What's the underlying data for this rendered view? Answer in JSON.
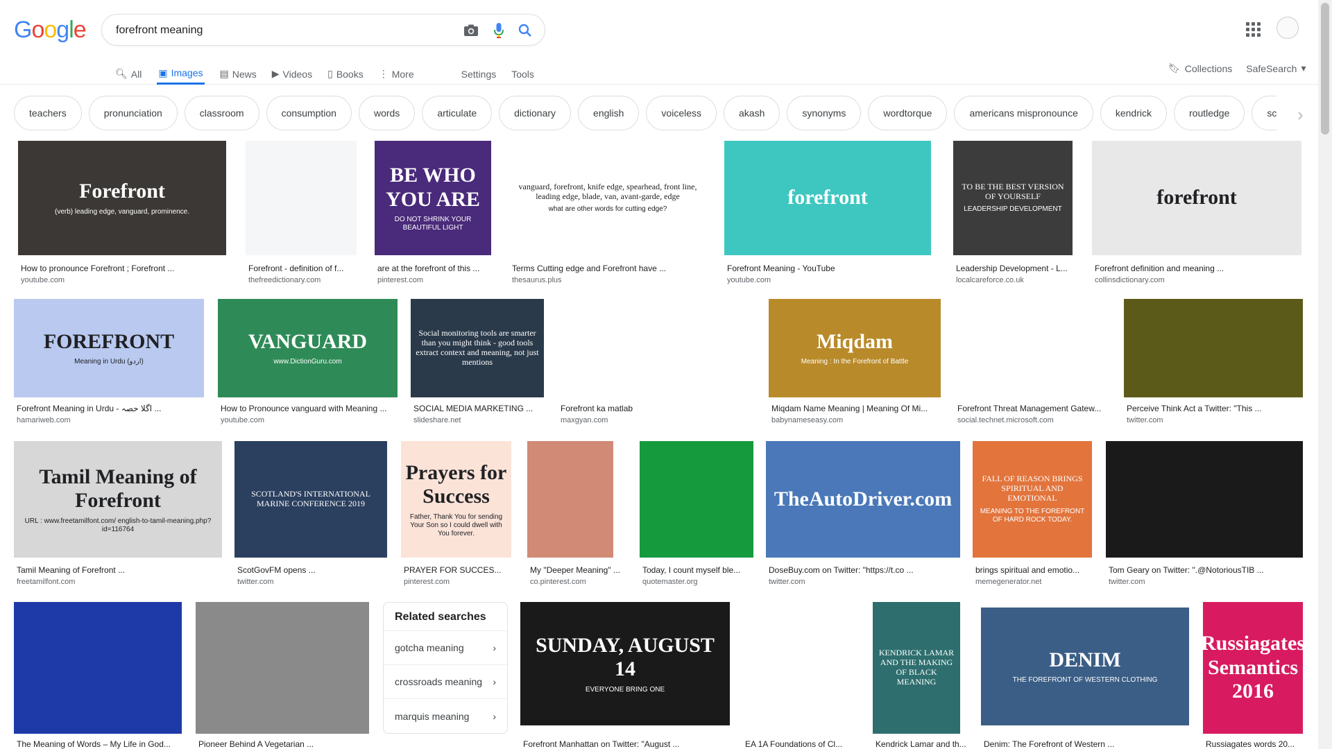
{
  "logo": {
    "letters": [
      "G",
      "o",
      "o",
      "g",
      "l",
      "e"
    ],
    "colors": [
      "#4285f4",
      "#ea4335",
      "#fbbc05",
      "#4285f4",
      "#34a853",
      "#ea4335"
    ]
  },
  "search": {
    "query": "forefront meaning",
    "icons": [
      "camera-icon",
      "mic-icon",
      "search-icon"
    ]
  },
  "tabs": [
    {
      "label": "All",
      "icon": "search-icon"
    },
    {
      "label": "Images",
      "icon": "image-icon",
      "active": true
    },
    {
      "label": "News",
      "icon": "news-icon"
    },
    {
      "label": "Videos",
      "icon": "video-icon"
    },
    {
      "label": "Books",
      "icon": "book-icon"
    },
    {
      "label": "More",
      "icon": "dots-icon"
    }
  ],
  "tools": {
    "settings": "Settings",
    "tools": "Tools"
  },
  "right_tools": {
    "collections": "Collections",
    "safesearch": "SafeSearch"
  },
  "chips": [
    "teachers",
    "pronunciation",
    "classroom",
    "consumption",
    "words",
    "articulate",
    "dictionary",
    "english",
    "voiceless",
    "akash",
    "synonyms",
    "wordtorque",
    "americans mispronounce",
    "kendrick",
    "routledge",
    "scotland"
  ],
  "results": [
    {
      "caption": "How to pronounce Forefront ; Forefront ...",
      "domain": "youtube.com",
      "thumb_text": "Forefront",
      "thumb_sub": "(verb) leading edge, vanguard, prominence.",
      "color": "#3b3835"
    },
    {
      "caption": "Forefront - definition of f...",
      "domain": "thefreedictionary.com",
      "thumb_text": "",
      "thumb_sub": "",
      "color": "#f4f6f8"
    },
    {
      "caption": "are at the forefront of this ...",
      "domain": "pinterest.com",
      "thumb_text": "BE WHO YOU ARE",
      "thumb_sub": "DO NOT SHRINK YOUR BEAUTIFUL LIGHT",
      "color": "#4a2a7a"
    },
    {
      "caption": "Terms Cutting edge and Forefront have ...",
      "domain": "thesaurus.plus",
      "thumb_text": "vanguard, forefront, knife edge, spearhead, front line, leading edge, blade, van, avant-garde, edge",
      "thumb_sub": "what are other words for cutting edge?",
      "color": "#ffffff"
    },
    {
      "caption": "Forefront Meaning - YouTube",
      "domain": "youtube.com",
      "thumb_text": "forefront",
      "thumb_sub": "",
      "color": "#3ec7c0"
    },
    {
      "caption": "Leadership Development - L...",
      "domain": "localcareforce.co.uk",
      "thumb_text": "TO BE THE BEST VERSION OF YOURSELF",
      "thumb_sub": "LEADERSHIP DEVELOPMENT",
      "color": "#3c3c3c"
    },
    {
      "caption": "Forefront definition and meaning ...",
      "domain": "collinsdictionary.com",
      "thumb_text": "forefront",
      "thumb_sub": "",
      "color": "#e8e8e8"
    },
    {
      "caption": "Forefront Meaning in Urdu - اگلا حصہ ...",
      "domain": "hamariweb.com",
      "thumb_text": "FOREFRONT",
      "thumb_sub": "Meaning in Urdu (اردو)",
      "color": "#b9c9f0"
    },
    {
      "caption": "How to Pronounce vanguard with Meaning ...",
      "domain": "youtube.com",
      "thumb_text": "VANGUARD",
      "thumb_sub": "www.DictionGuru.com",
      "color": "#2e8b57"
    },
    {
      "caption": "SOCIAL MEDIA MARKETING ...",
      "domain": "slideshare.net",
      "thumb_text": "Social monitoring tools are smarter than you might think - good tools extract context and meaning, not just mentions",
      "thumb_sub": "",
      "color": "#2a3a4a"
    },
    {
      "caption": "Forefront ka matlab",
      "domain": "maxgyan.com",
      "thumb_text": "",
      "thumb_sub": "",
      "color": "#ffffff"
    },
    {
      "caption": "Miqdam Name Meaning | Meaning Of Mi...",
      "domain": "babynameseasy.com",
      "thumb_text": "Miqdam",
      "thumb_sub": "Meaning : In the Forefront of Battle",
      "color": "#b88a2a"
    },
    {
      "caption": "Forefront Threat Management Gatew...",
      "domain": "social.technet.microsoft.com",
      "thumb_text": "",
      "thumb_sub": "",
      "color": "#ffffff"
    },
    {
      "caption": "Perceive Think Act a Twitter: \"This ...",
      "domain": "twitter.com",
      "thumb_text": "",
      "thumb_sub": "",
      "color": "#5c5a18"
    },
    {
      "caption": "Tamil Meaning of Forefront ...",
      "domain": "freetamilfont.com",
      "thumb_text": "Tamil Meaning of Forefront",
      "thumb_sub": "URL : www.freetamilfont.com/ english-to-tamil-meaning.php?id=116764",
      "color": "#d7d7d7"
    },
    {
      "caption": "ScotGovFM opens ...",
      "domain": "twitter.com",
      "thumb_text": "SCOTLAND'S INTERNATIONAL MARINE CONFERENCE 2019",
      "thumb_sub": "",
      "color": "#2b3f5f"
    },
    {
      "caption": "PRAYER FOR SUCCES...",
      "domain": "pinterest.com",
      "thumb_text": "Prayers for Success",
      "thumb_sub": "Father, Thank You for sending Your Son so I could dwell with You forever.",
      "color": "#fbe3d8"
    },
    {
      "caption": "My \"Deeper Meaning\" ...",
      "domain": "co.pinterest.com",
      "thumb_text": "",
      "thumb_sub": "",
      "color": "#d08a76"
    },
    {
      "caption": "Today, I count myself ble...",
      "domain": "quotemaster.org",
      "thumb_text": "",
      "thumb_sub": "",
      "color": "#169a3e"
    },
    {
      "caption": "DoseBuy.com on Twitter: \"https://t.co ...",
      "domain": "twitter.com",
      "thumb_text": "TheAutoDriver.com",
      "thumb_sub": "",
      "color": "#4a78b8"
    },
    {
      "caption": "brings spiritual and emotio...",
      "domain": "memegenerator.net",
      "thumb_text": "FALL OF REASON BRINGS SPIRITUAL AND EMOTIONAL",
      "thumb_sub": "MEANING TO THE FOREFRONT OF HARD ROCK TODAY.",
      "color": "#e2743c"
    },
    {
      "caption": "Tom Geary on Twitter: \".@NotoriousTIB ...",
      "domain": "twitter.com",
      "thumb_text": "",
      "thumb_sub": "",
      "color": "#1a1a1a"
    },
    {
      "caption": "The Meaning of Words – My Life in God...",
      "domain": "",
      "thumb_text": "",
      "thumb_sub": "",
      "color": "#1e3aa8"
    },
    {
      "caption": "Pioneer Behind A Vegetarian ...",
      "domain": "",
      "thumb_text": "",
      "thumb_sub": "",
      "color": "#8a8a8a"
    },
    {
      "caption": "Forefront Manhattan on Twitter: \"August ...",
      "domain": "",
      "thumb_text": "SUNDAY, AUGUST 14",
      "thumb_sub": "EVERYONE BRING ONE",
      "color": "#1a1a1a"
    },
    {
      "caption": "EA 1A Foundations of Cl...",
      "domain": "",
      "thumb_text": "",
      "thumb_sub": "",
      "color": "#ffffff"
    },
    {
      "caption": "Kendrick Lamar and th...",
      "domain": "",
      "thumb_text": "KENDRICK LAMAR AND THE MAKING OF BLACK MEANING",
      "thumb_sub": "",
      "color": "#2e6e6e"
    },
    {
      "caption": "Denim: The Forefront of Western ...",
      "domain": "",
      "thumb_text": "DENIM",
      "thumb_sub": "THE FOREFRONT OF WESTERN CLOTHING",
      "color": "#3b5e86"
    },
    {
      "caption": "Russiagates words 20...",
      "domain": "",
      "thumb_text": "Russiagates Semantics 2016",
      "thumb_sub": "",
      "color": "#d81b60"
    }
  ],
  "related": {
    "title": "Related searches",
    "items": [
      "gotcha meaning",
      "crossroads meaning",
      "marquis meaning"
    ]
  }
}
